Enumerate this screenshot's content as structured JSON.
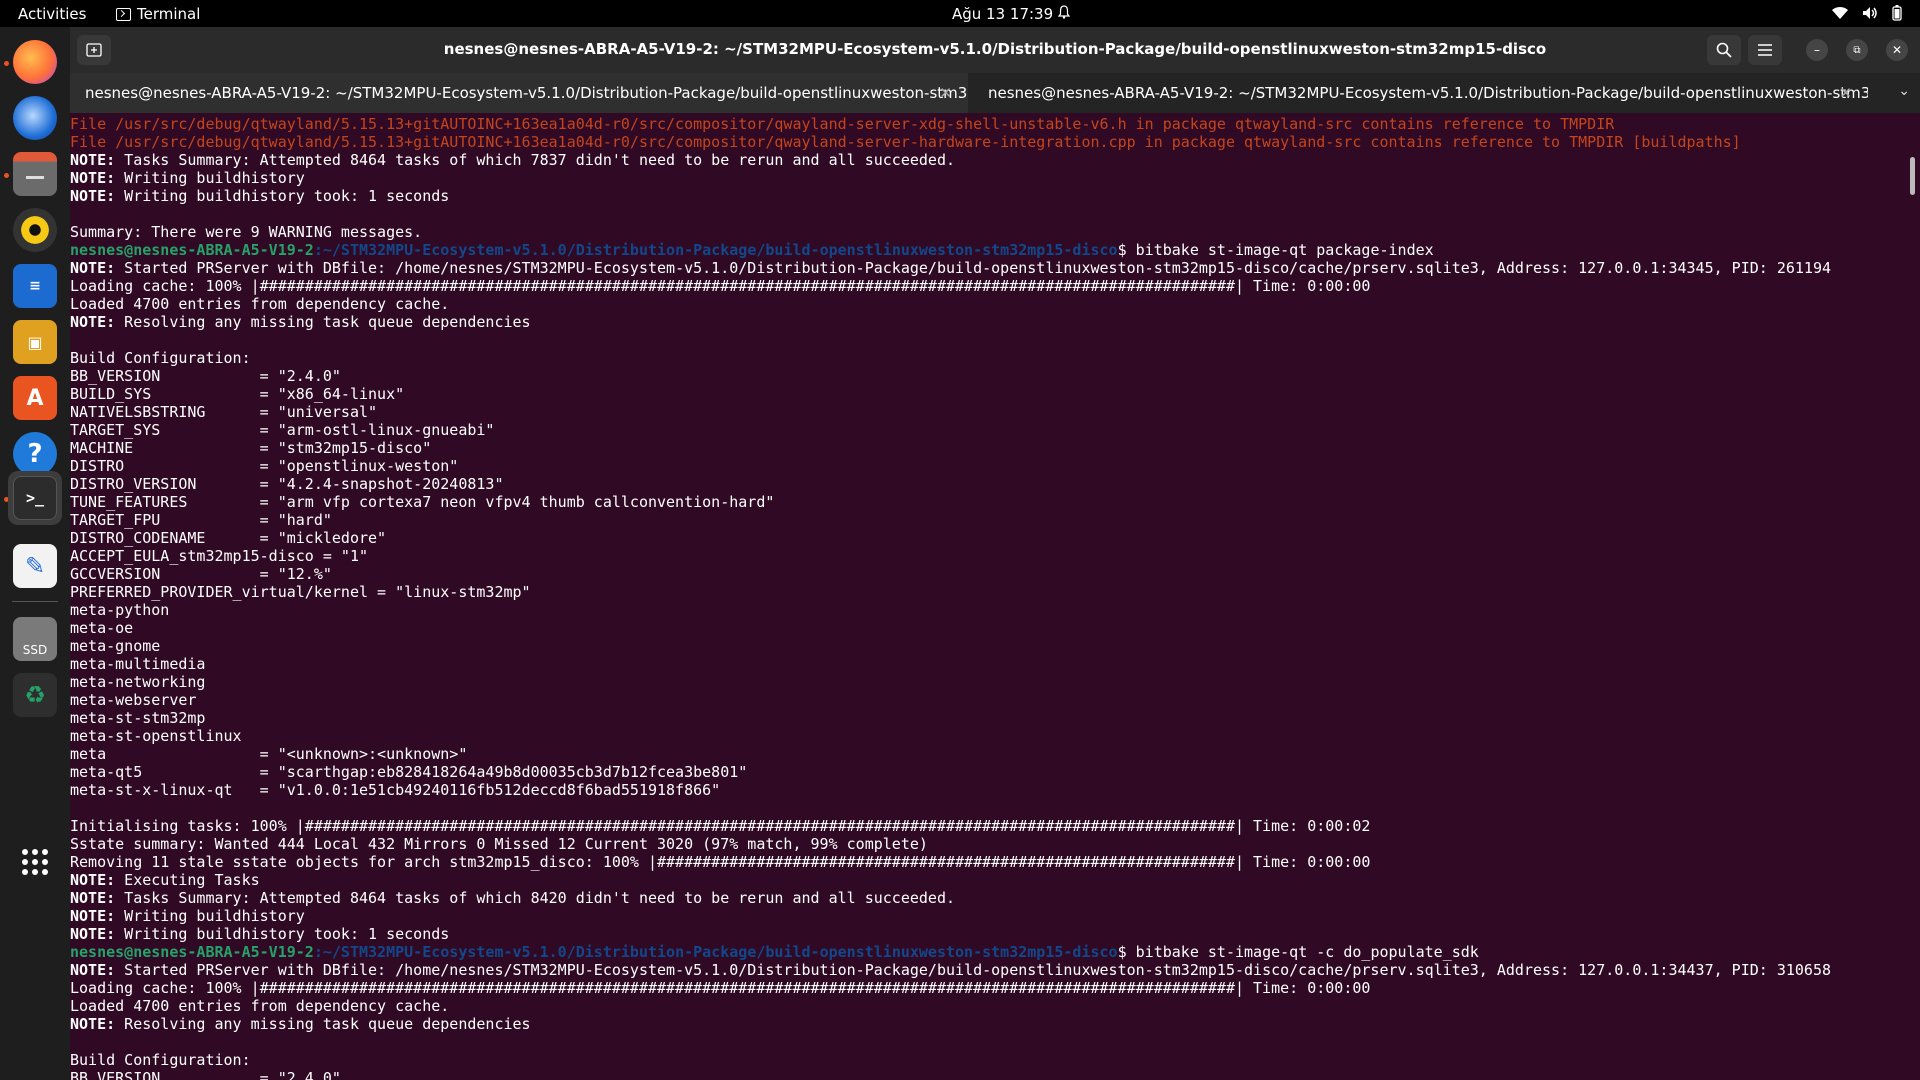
{
  "topbar": {
    "activities": "Activities",
    "app_name": "Terminal",
    "clock": "Ağu 13  17:39"
  },
  "dock": {
    "items": [
      {
        "icon": "firefox-icon",
        "color": "#ff7139"
      },
      {
        "icon": "thunderbird-icon",
        "color": "#1f6fd6"
      },
      {
        "icon": "files-icon",
        "color": "#6b6b6b"
      },
      {
        "icon": "rhythmbox-icon",
        "color": "#f6c915"
      },
      {
        "icon": "writer-icon",
        "color": "#1c6bd0"
      },
      {
        "icon": "impress-icon",
        "color": "#e0a020"
      },
      {
        "icon": "app-center-icon",
        "color": "#e95420"
      },
      {
        "icon": "help-icon",
        "color": "#1f7ad9"
      },
      {
        "icon": "terminal-icon",
        "color": "#2c2c2c"
      },
      {
        "icon": "text-editor-icon",
        "color": "#2a6fd6"
      },
      {
        "icon": "ssd-drive-icon",
        "color": "#7a7a7a",
        "label": "SSD"
      },
      {
        "icon": "trash-icon",
        "color": "#2e2e2e"
      }
    ],
    "show_apps_icon": "app-grid-icon"
  },
  "window": {
    "title": "nesnes@nesnes-ABRA-A5-V19-2: ~/STM32MPU-Ecosystem-v5.1.0/Distribution-Package/build-openstlinuxweston-stm32mp15-disco",
    "tabs": [
      {
        "label": "nesnes@nesnes-ABRA-A5-V19-2: ~/STM32MPU-Ecosystem-v5.1.0/Distribution-Package/build-openstlinuxweston-stm32mp1..."
      },
      {
        "label": "nesnes@nesnes-ABRA-A5-V19-2: ~/STM32MPU-Ecosystem-v5.1.0/Distribution-Package/build-openstlinuxweston-stm32mp1..."
      }
    ],
    "close_glyph": "✕",
    "tabs_menu_glyph": "⌄"
  },
  "terminal": {
    "colors": {
      "error": "#c4451c",
      "prompt_user": "#26a269",
      "prompt_path": "#12488b",
      "text": "#ffffff",
      "background": "#300a24"
    },
    "lines": [
      {
        "t": "File /usr/src/debug/qtwayland/5.15.13+gitAUTOINC+163ea1a04d-r0/src/compositor/qwayland-server-xdg-shell-unstable-v6.h in package qtwayland-src contains reference to TMPDIR",
        "c": "err"
      },
      {
        "t": "File /usr/src/debug/qtwayland/5.15.13+gitAUTOINC+163ea1a04d-r0/src/compositor/qwayland-server-hardware-integration.cpp in package qtwayland-src contains reference to TMPDIR [buildpaths]",
        "c": "err"
      },
      {
        "n": "NOTE:",
        "t": " Tasks Summary: Attempted 8464 tasks of which 7837 didn't need to be rerun and all succeeded."
      },
      {
        "n": "NOTE:",
        "t": " Writing buildhistory"
      },
      {
        "n": "NOTE:",
        "t": " Writing buildhistory took: 1 seconds"
      },
      {
        "t": ""
      },
      {
        "t": "Summary: There were 9 WARNING messages."
      },
      {
        "p": "nesnes@nesnes-ABRA-A5-V19-2",
        "path": ":~/STM32MPU-Ecosystem-v5.1.0/Distribution-Package/build-openstlinuxweston-stm32mp15-disco",
        "t": "$ bitbake st-image-qt package-index"
      },
      {
        "n": "NOTE:",
        "t": " Started PRServer with DBfile: /home/nesnes/STM32MPU-Ecosystem-v5.1.0/Distribution-Package/build-openstlinuxweston-stm32mp15-disco/cache/prserv.sqlite3, Address: 127.0.0.1:34345, PID: 261194"
      },
      {
        "t": "Loading cache: 100% |############################################################################################################| Time: 0:00:00"
      },
      {
        "t": "Loaded 4700 entries from dependency cache."
      },
      {
        "n": "NOTE:",
        "t": " Resolving any missing task queue dependencies"
      },
      {
        "t": ""
      },
      {
        "t": "Build Configuration:"
      },
      {
        "t": "BB_VERSION           = \"2.4.0\""
      },
      {
        "t": "BUILD_SYS            = \"x86_64-linux\""
      },
      {
        "t": "NATIVELSBSTRING      = \"universal\""
      },
      {
        "t": "TARGET_SYS           = \"arm-ostl-linux-gnueabi\""
      },
      {
        "t": "MACHINE              = \"stm32mp15-disco\""
      },
      {
        "t": "DISTRO               = \"openstlinux-weston\""
      },
      {
        "t": "DISTRO_VERSION       = \"4.2.4-snapshot-20240813\""
      },
      {
        "t": "TUNE_FEATURES        = \"arm vfp cortexa7 neon vfpv4 thumb callconvention-hard\""
      },
      {
        "t": "TARGET_FPU           = \"hard\""
      },
      {
        "t": "DISTRO_CODENAME      = \"mickledore\""
      },
      {
        "t": "ACCEPT_EULA_stm32mp15-disco = \"1\""
      },
      {
        "t": "GCCVERSION           = \"12.%\""
      },
      {
        "t": "PREFERRED_PROVIDER_virtual/kernel = \"linux-stm32mp\""
      },
      {
        "t": "meta-python"
      },
      {
        "t": "meta-oe"
      },
      {
        "t": "meta-gnome"
      },
      {
        "t": "meta-multimedia"
      },
      {
        "t": "meta-networking"
      },
      {
        "t": "meta-webserver"
      },
      {
        "t": "meta-st-stm32mp"
      },
      {
        "t": "meta-st-openstlinux"
      },
      {
        "t": "meta                 = \"<unknown>:<unknown>\""
      },
      {
        "t": "meta-qt5             = \"scarthgap:eb828418264a49b8d00035cb3d7b12fcea3be801\""
      },
      {
        "t": "meta-st-x-linux-qt   = \"v1.0.0:1e51cb49240116fb512deccd8f6bad551918f866\""
      },
      {
        "t": ""
      },
      {
        "t": "Initialising tasks: 100% |#######################################################################################################| Time: 0:00:02"
      },
      {
        "t": "Sstate summary: Wanted 444 Local 432 Mirrors 0 Missed 12 Current 3020 (97% match, 99% complete)"
      },
      {
        "t": "Removing 11 stale sstate objects for arch stm32mp15_disco: 100% |################################################################| Time: 0:00:00"
      },
      {
        "n": "NOTE:",
        "t": " Executing Tasks"
      },
      {
        "n": "NOTE:",
        "t": " Tasks Summary: Attempted 8464 tasks of which 8420 didn't need to be rerun and all succeeded."
      },
      {
        "n": "NOTE:",
        "t": " Writing buildhistory"
      },
      {
        "n": "NOTE:",
        "t": " Writing buildhistory took: 1 seconds"
      },
      {
        "p": "nesnes@nesnes-ABRA-A5-V19-2",
        "path": ":~/STM32MPU-Ecosystem-v5.1.0/Distribution-Package/build-openstlinuxweston-stm32mp15-disco",
        "t": "$ bitbake st-image-qt -c do_populate_sdk"
      },
      {
        "n": "NOTE:",
        "t": " Started PRServer with DBfile: /home/nesnes/STM32MPU-Ecosystem-v5.1.0/Distribution-Package/build-openstlinuxweston-stm32mp15-disco/cache/prserv.sqlite3, Address: 127.0.0.1:34437, PID: 310658"
      },
      {
        "t": "Loading cache: 100% |############################################################################################################| Time: 0:00:00"
      },
      {
        "t": "Loaded 4700 entries from dependency cache."
      },
      {
        "n": "NOTE:",
        "t": " Resolving any missing task queue dependencies"
      },
      {
        "t": ""
      },
      {
        "t": "Build Configuration:"
      },
      {
        "t": "BB_VERSION           = \"2.4.0\""
      }
    ]
  }
}
